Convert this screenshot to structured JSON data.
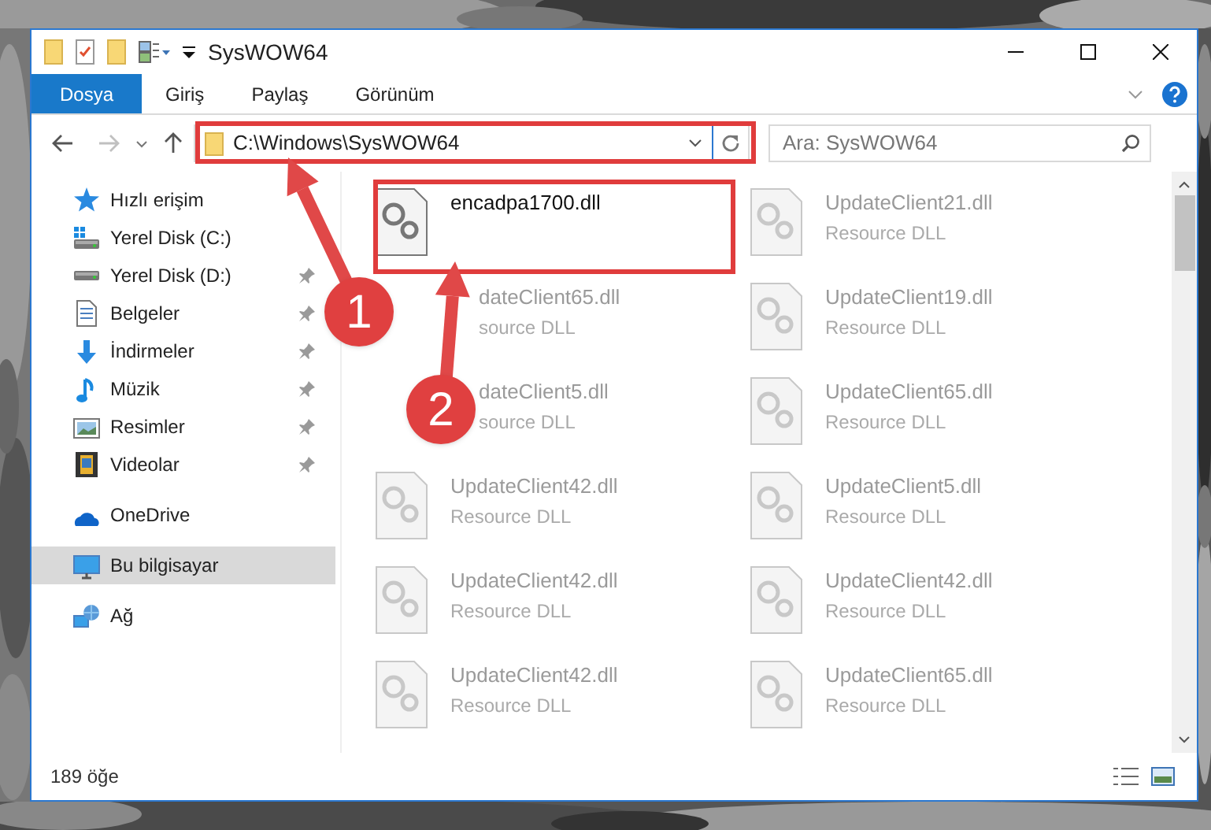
{
  "window": {
    "title": "SysWOW64"
  },
  "ribbon_tabs": [
    {
      "label": "Dosya",
      "selected": true
    },
    {
      "label": "Giriş",
      "selected": false
    },
    {
      "label": "Paylaş",
      "selected": false
    },
    {
      "label": "Görünüm",
      "selected": false
    }
  ],
  "address": {
    "path": "C:\\Windows\\SysWOW64"
  },
  "search": {
    "placeholder": "Ara: SysWOW64"
  },
  "sidebar": {
    "items": [
      {
        "label": "Hızlı erişim",
        "kind": "star",
        "selected": false,
        "children": [
          {
            "label": "Yerel Disk (C:)",
            "kind": "windrive",
            "pinned": false
          },
          {
            "label": "Yerel Disk (D:)",
            "kind": "drive",
            "pinned": true
          },
          {
            "label": "Belgeler",
            "kind": "document",
            "pinned": true
          },
          {
            "label": "İndirmeler",
            "kind": "download",
            "pinned": true
          },
          {
            "label": "Müzik",
            "kind": "music",
            "pinned": true
          },
          {
            "label": "Resimler",
            "kind": "pictures",
            "pinned": true
          },
          {
            "label": "Videolar",
            "kind": "videos",
            "pinned": true
          }
        ]
      },
      {
        "label": "OneDrive",
        "kind": "cloud",
        "selected": false
      },
      {
        "label": "Bu bilgisayar",
        "kind": "computer",
        "selected": true
      },
      {
        "label": "Ağ",
        "kind": "network",
        "selected": false
      }
    ]
  },
  "files": [
    {
      "name": "encadpa1700.dll",
      "blurred": false
    },
    {
      "name": "UpdateClient21.dll",
      "type": "Resource DLL",
      "blurred": true
    },
    {
      "name": "dateClient65.dll",
      "type": "source DLL",
      "blurred": true,
      "covered": true
    },
    {
      "name": "UpdateClient19.dll",
      "type": "Resource DLL",
      "blurred": true
    },
    {
      "name": "dateClient5.dll",
      "type": "source DLL",
      "blurred": true,
      "covered": true
    },
    {
      "name": "UpdateClient65.dll",
      "type": "Resource DLL",
      "blurred": true
    },
    {
      "name": "UpdateClient42.dll",
      "type": "Resource DLL",
      "blurred": true
    },
    {
      "name": "UpdateClient5.dll",
      "type": "Resource DLL",
      "blurred": true
    },
    {
      "name": "UpdateClient42.dll",
      "type": "Resource DLL",
      "blurred": true
    },
    {
      "name": "UpdateClient42.dll",
      "type": "Resource DLL",
      "blurred": true
    },
    {
      "name": "UpdateClient42.dll",
      "type": "Resource DLL",
      "blurred": true
    },
    {
      "name": "UpdateClient65.dll",
      "type": "Resource DLL",
      "blurred": true
    }
  ],
  "status_bar": {
    "count": "189 öğe"
  },
  "callouts": [
    {
      "label": "1"
    },
    {
      "label": "2"
    }
  ]
}
